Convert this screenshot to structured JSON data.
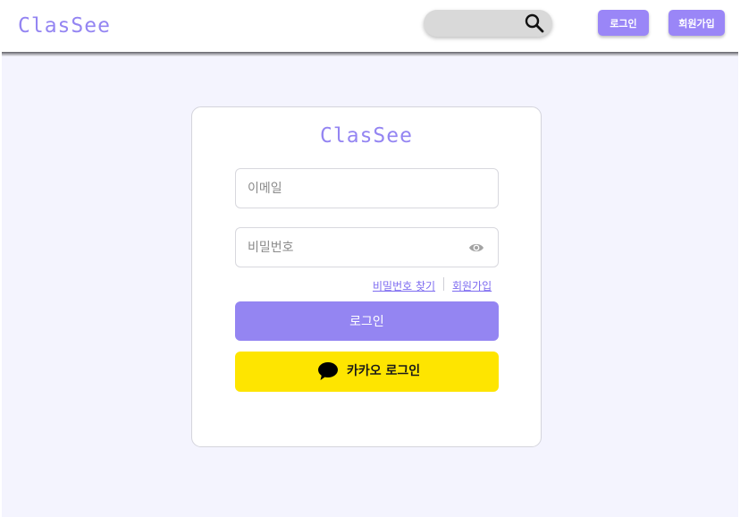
{
  "header": {
    "logo": "ClasSee",
    "search": {
      "value": "",
      "placeholder": ""
    },
    "login_label": "로그인",
    "signup_label": "회원가입"
  },
  "login_card": {
    "logo": "ClasSee",
    "email": {
      "value": "",
      "placeholder": "이메일"
    },
    "password": {
      "value": "",
      "placeholder": "비밀번호"
    },
    "links": {
      "find_password": "비밀번호 찾기",
      "signup": "회원가입"
    },
    "login_button": "로그인",
    "kakao_button": "카카오 로그인"
  },
  "colors": {
    "brand": "#9485f2",
    "kakao": "#fee500",
    "background": "#f4f4fe"
  },
  "icons": [
    "search-icon",
    "eye-icon",
    "kakao-speech-bubble-icon"
  ]
}
